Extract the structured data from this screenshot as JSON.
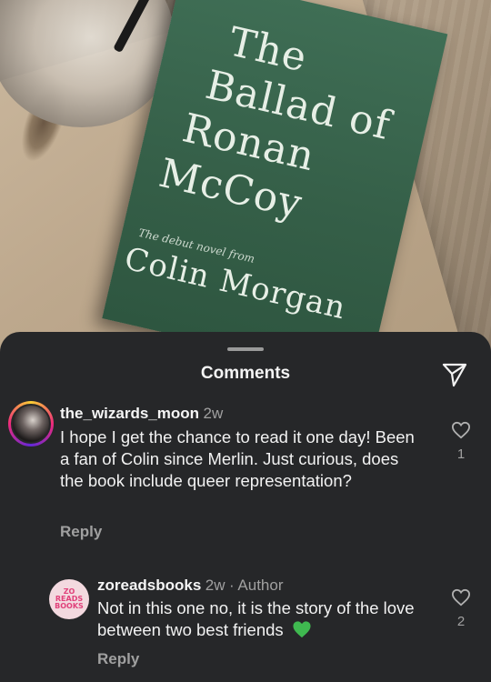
{
  "photo": {
    "book": {
      "title_lines": [
        "The",
        "Ballad of",
        "Ronan",
        "McCoy"
      ],
      "tagline": "The debut novel from",
      "author": "Colin Morgan",
      "cover_color": "#355f48"
    }
  },
  "sheet": {
    "title": "Comments",
    "send_icon": "send-paper-plane-icon"
  },
  "comments": [
    {
      "username": "the_wizards_moon",
      "age": "2w",
      "text": "I hope I get the chance to read it one day! Been a fan of Colin since Merlin. Just curious, does the book include queer representation?",
      "reply_label": "Reply",
      "like_count": "1",
      "avatar": "profile-photo-avatar-with-story-ring"
    },
    {
      "username": "zoreadsbooks",
      "age": "2w",
      "author_badge": "· Author",
      "avatar_logo_text": "ZO READS BOOKS",
      "text": "Not in this one no, it is the story of the love between two best friends",
      "emoji": "green-heart-emoji",
      "reply_label": "Reply",
      "like_count": "2"
    }
  ],
  "colors": {
    "sheet_bg": "#262729",
    "secondary_text": "#a0a0a0",
    "primary_text": "#f2f2f2",
    "heart_emoji": "#3fb950"
  }
}
